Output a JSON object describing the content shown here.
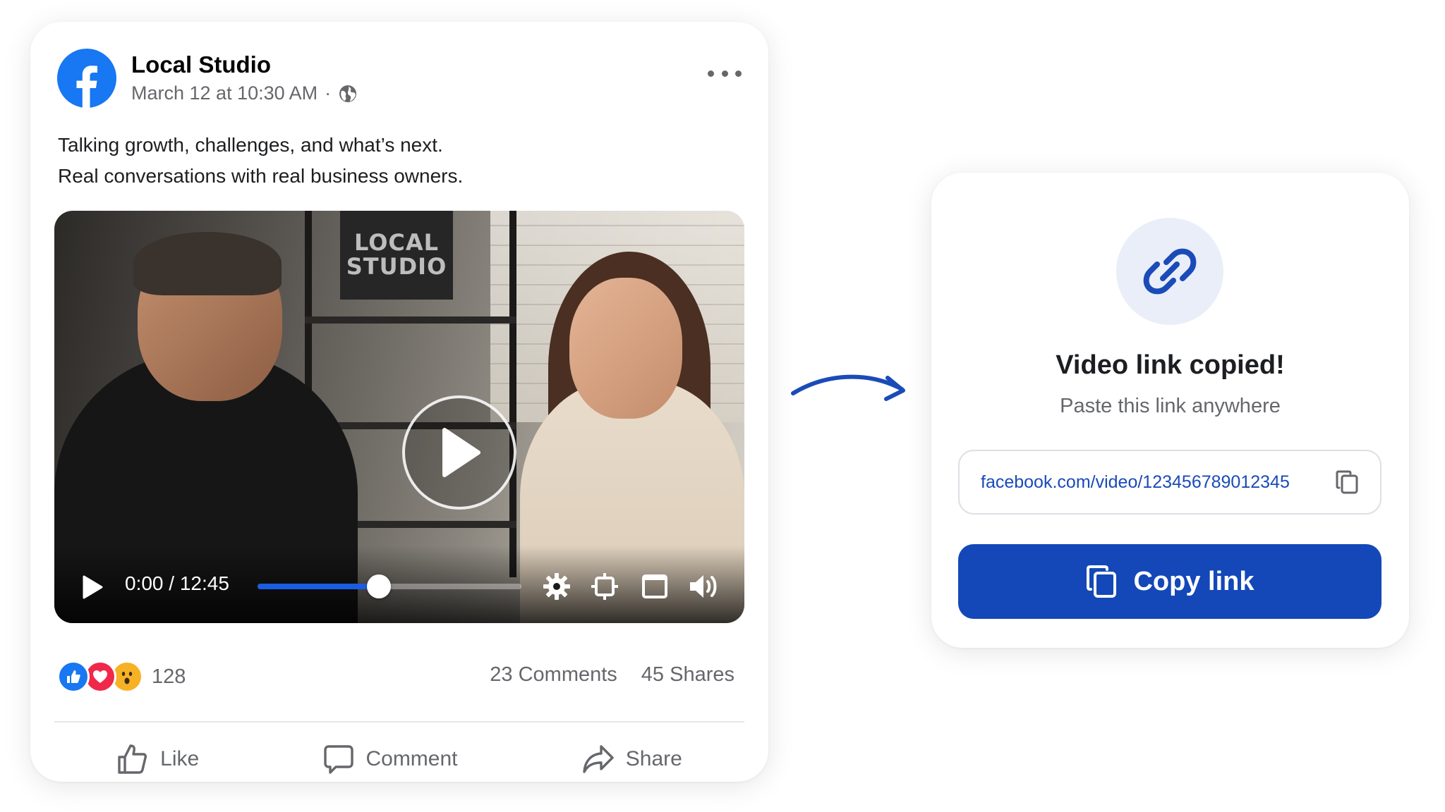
{
  "post": {
    "author": "Local Studio",
    "date": "March 12 at 10:30 AM",
    "separator": "·",
    "caption_lines": [
      "Talking growth, challenges, and what’s next.",
      "Real conversations with real business owners."
    ],
    "video": {
      "sign_text": [
        "LOCAL",
        "STUDIO"
      ],
      "time_display": "0:00 / 12:45",
      "progress_fraction": 0.46
    },
    "reactions": {
      "count": "128",
      "types": [
        "like",
        "love",
        "wow"
      ]
    },
    "comments": "23 Comments",
    "shares": "45 Shares",
    "actions": {
      "like": "Like",
      "comment": "Comment",
      "share": "Share"
    }
  },
  "copied_dialog": {
    "title": "Video link copied!",
    "subtitle": "Paste this link anywhere",
    "url": "facebook.com/video/123456789012345",
    "button_label": "Copy link"
  },
  "colors": {
    "facebook_blue": "#1877F2",
    "button_blue": "#1448B8",
    "link_blue": "#1A4BB8",
    "muted_text": "#65676B",
    "progress_blue": "#1B5DE0"
  },
  "icons": [
    "facebook-logo-icon",
    "globe-icon",
    "more-icon",
    "play-icon",
    "settings-icon",
    "crop-icon",
    "fullscreen-icon",
    "volume-icon",
    "like-icon",
    "comment-icon",
    "share-icon",
    "link-icon",
    "copy-icon",
    "arrow-icon"
  ]
}
